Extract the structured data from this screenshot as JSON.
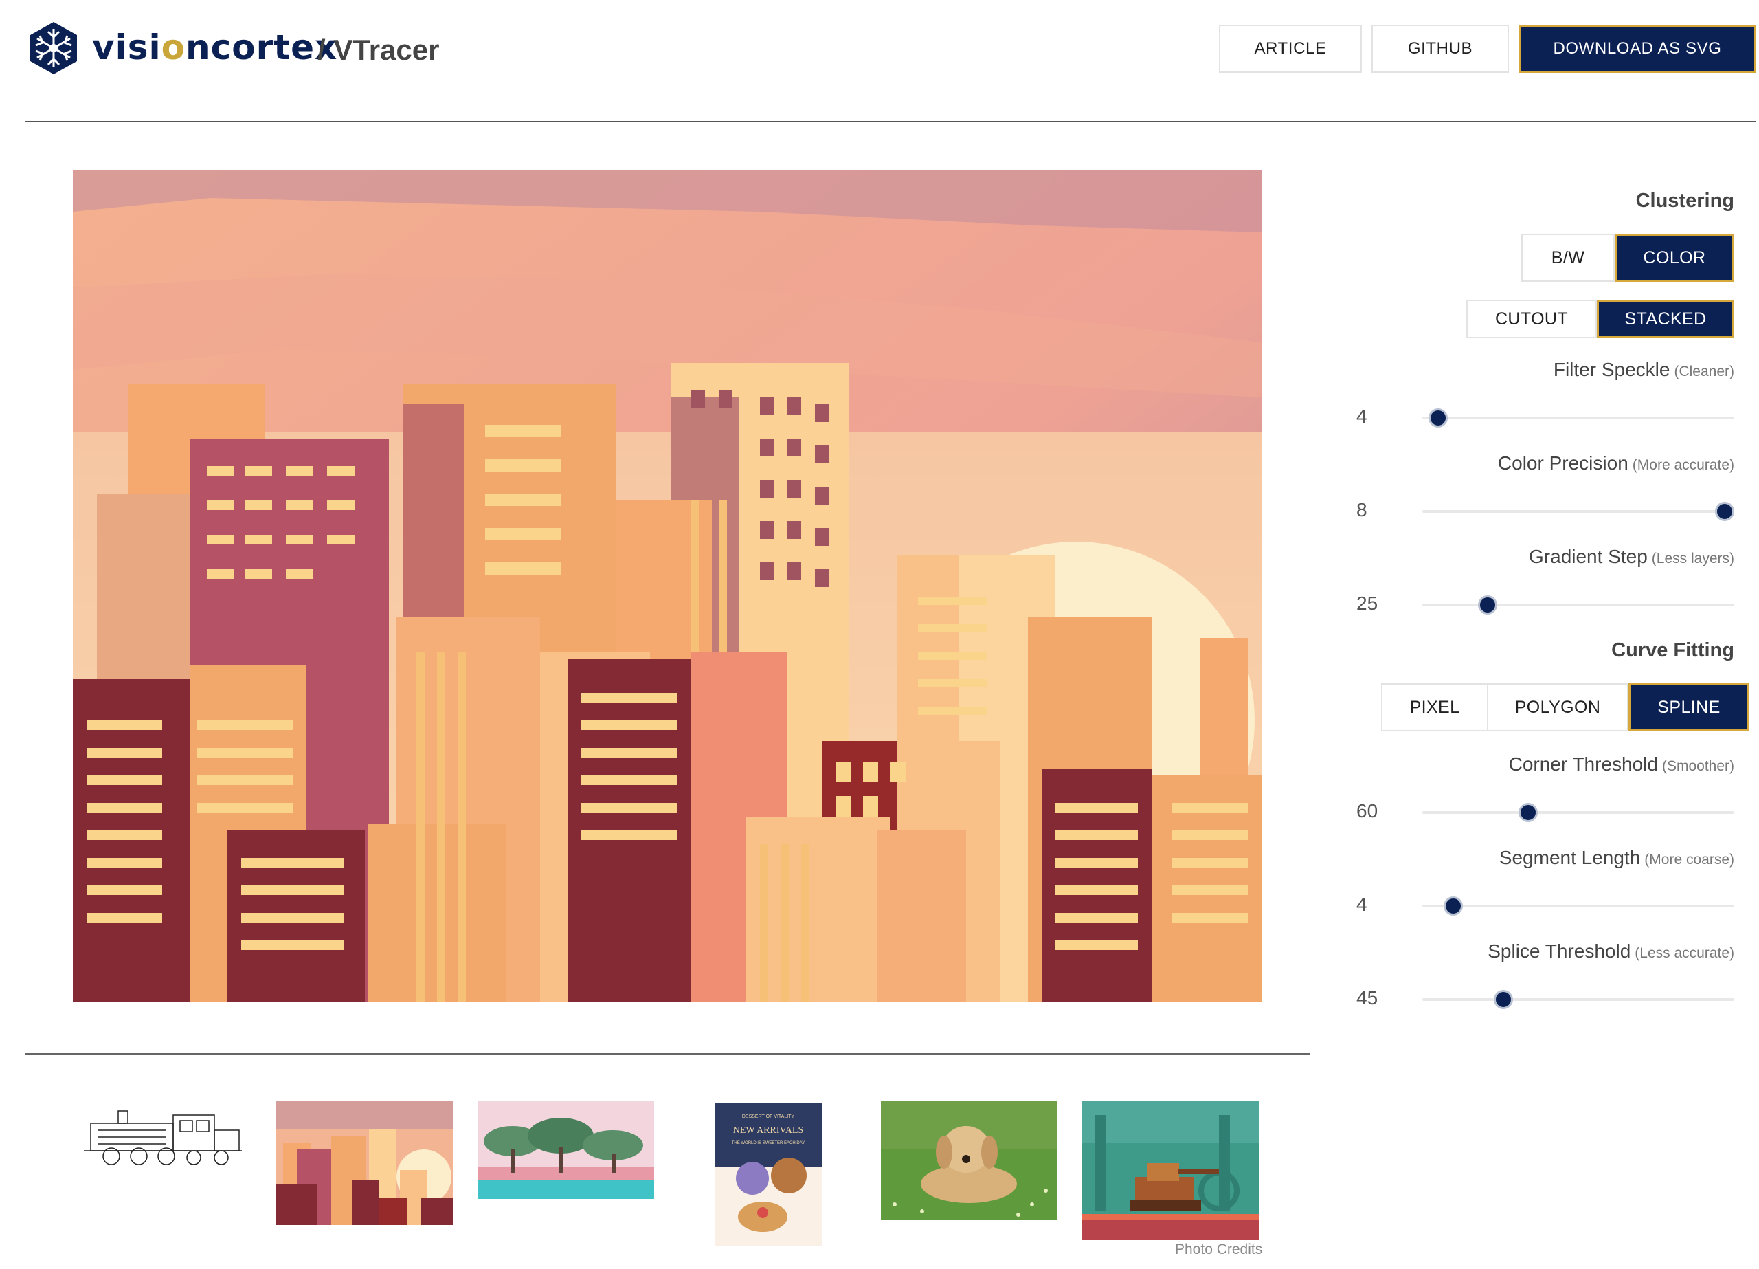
{
  "header": {
    "brand_a": "visi",
    "brand_o": "o",
    "brand_b": "ncortex",
    "product": "/ VTracer",
    "logo_icon": "snowflake-logo-icon",
    "buttons": {
      "article": "ARTICLE",
      "github": "GITHUB",
      "download": "DOWNLOAD AS SVG"
    }
  },
  "colors": {
    "navy": "#0b2154",
    "gold": "#d6a83b"
  },
  "panel": {
    "clustering": {
      "title": "Clustering",
      "mode": {
        "options": [
          "B/W",
          "COLOR"
        ],
        "selected": "COLOR"
      },
      "hierarchy": {
        "options": [
          "CUTOUT",
          "STACKED"
        ],
        "selected": "STACKED"
      }
    },
    "sliders_a": [
      {
        "label": "Filter Speckle",
        "hint": "(Cleaner)",
        "value": "4",
        "level": 0.05
      },
      {
        "label": "Color Precision",
        "hint": "(More accurate)",
        "value": "8",
        "level": 0.97
      },
      {
        "label": "Gradient Step",
        "hint": "(Less layers)",
        "value": "25",
        "level": 0.21
      }
    ],
    "curve": {
      "title": "Curve Fitting",
      "mode": {
        "options": [
          "PIXEL",
          "POLYGON",
          "SPLINE"
        ],
        "selected": "SPLINE"
      }
    },
    "sliders_b": [
      {
        "label": "Corner Threshold",
        "hint": "(Smoother)",
        "value": "60",
        "level": 0.34
      },
      {
        "label": "Segment Length",
        "hint": "(More coarse)",
        "value": "4",
        "level": 0.1
      },
      {
        "label": "Splice Threshold",
        "hint": "(Less accurate)",
        "value": "45",
        "level": 0.26
      }
    ]
  },
  "gallery": {
    "items": [
      "train-sketch",
      "city-sunset",
      "trees-lake",
      "new-arrivals-poster",
      "dog-grass",
      "pixel-art-tank"
    ],
    "poster_line1": "DESSERT OF VITALITY",
    "poster_title": "NEW ARRIVALS",
    "poster_line2": "THE WORLD IS SWEETER EACH DAY",
    "credits": "Photo Credits"
  }
}
